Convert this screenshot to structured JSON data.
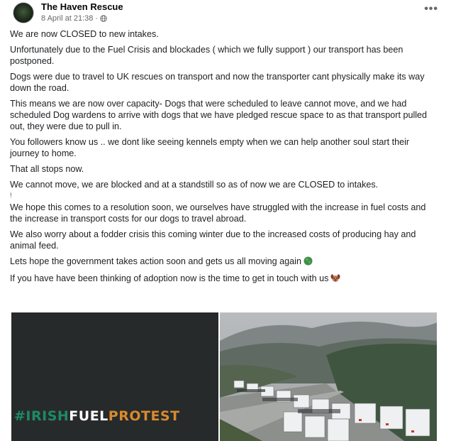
{
  "post": {
    "author": "The Haven Rescue",
    "timestamp": "8 April at 21:38",
    "separator": "·",
    "privacy_icon": "globe-icon",
    "more_label": "•••",
    "paragraphs": [
      "We are now CLOSED to new intakes.",
      "Unfortunately due to the Fuel Crisis and blockades ( which we fully support ) our transport has been postponed.",
      "Dogs were due to travel to UK rescues on transport and now the transporter cant physically make its way down the road.",
      "This means we are now over capacity- Dogs that were scheduled to leave cannot move, and we had scheduled Dog wardens to arrive with dogs that we have pledged rescue space to as that transport pulled out, they were due to pull in.",
      "You followers know us .. we dont like seeing kennels empty when we can help another soul start their journey to home.",
      "That all stops now.",
      "We cannot move, we are blocked and at a standstill so as of now we are CLOSED to intakes.",
      "We hope this comes to a resolution soon, we ourselves have struggled with the increase in fuel costs and the increase in transport costs for our dogs to travel abroad.",
      "We also worry about a fodder crisis this coming winter due to the increased costs of producing hay and animal feed.",
      "Lets hope the government takes action soon and gets us all moving again",
      "If you have have been thinking of adoption  now is the time to get in touch with us"
    ],
    "stray_mark": "!",
    "emoji_1": "earth-emoji",
    "emoji_2": "dog-face-emoji"
  },
  "media": {
    "left_image": {
      "hashtag_part1": "#IRISH",
      "hashtag_part2": "FUEL",
      "hashtag_part3": "PROTEST",
      "background_color": "#272a2b"
    },
    "right_image": {
      "description_icon": "truck-convoy-photo"
    }
  },
  "colors": {
    "author": "#050505",
    "meta": "#65676b",
    "hashtag_green": "#1d8a63",
    "hashtag_white": "#ffffff",
    "hashtag_orange": "#d88a2e"
  }
}
